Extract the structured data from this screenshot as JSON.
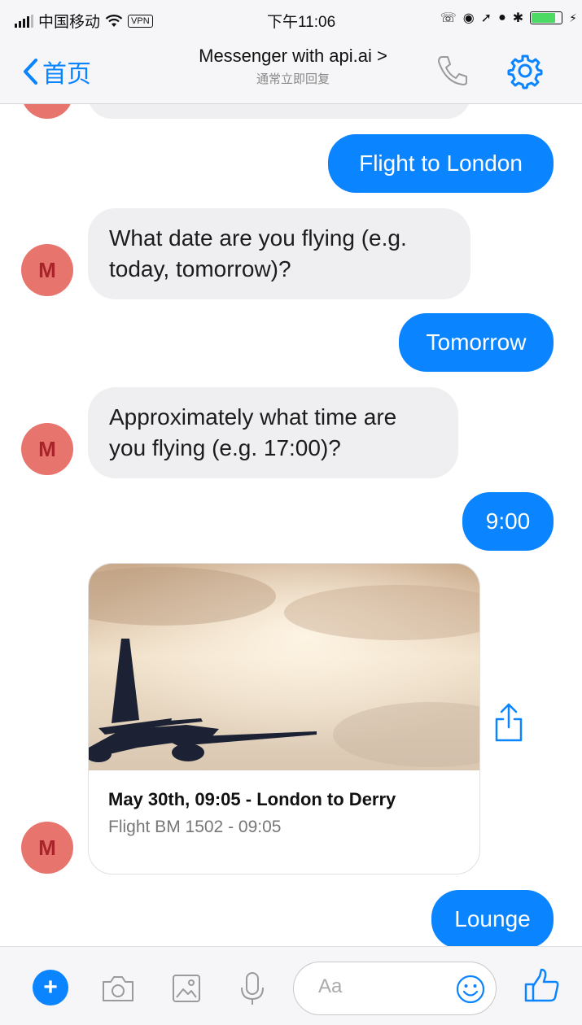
{
  "status_bar": {
    "carrier": "中国移动",
    "vpn": "VPN",
    "time": "下午11:06"
  },
  "nav": {
    "back_label": "首页",
    "title": "Messenger with api.ai >",
    "subtitle": "通常立即回复"
  },
  "messages": {
    "prev_partial": "",
    "user1": "Flight to London",
    "bot1": "What date are you flying (e.g. today, tomorrow)?",
    "user2": "Tomorrow",
    "bot2": "Approximately what time are you flying (e.g. 17:00)?",
    "user3": "9:00",
    "user4": "Lounge"
  },
  "avatar_initial": "M",
  "card": {
    "title": "May 30th, 09:05 - London to Derry",
    "subtitle": "Flight BM 1502 - 09:05"
  },
  "composer": {
    "placeholder": "Aa"
  },
  "colors": {
    "accent": "#0a84ff",
    "avatar_bg": "#e8756d",
    "incoming_bubble": "#efeff2"
  },
  "icons": [
    "chevron-left-icon",
    "phone-icon",
    "gear-icon",
    "share-icon",
    "plus-icon",
    "camera-icon",
    "image-icon",
    "microphone-icon",
    "emoji-icon",
    "thumbs-up-icon"
  ]
}
